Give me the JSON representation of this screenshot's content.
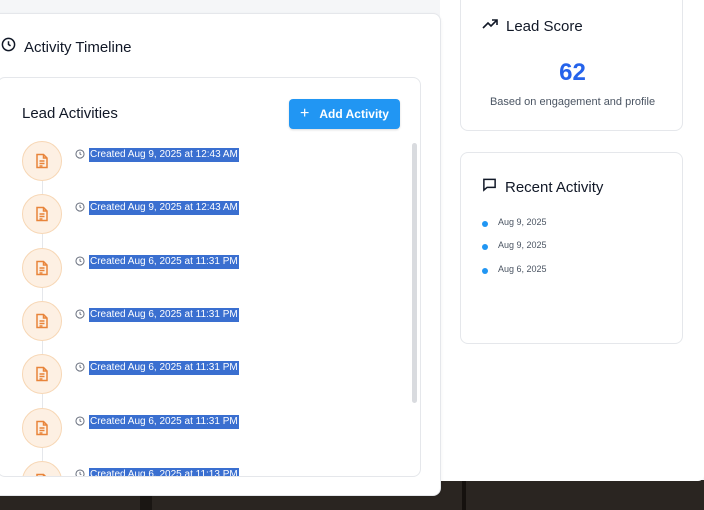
{
  "timeline": {
    "title": "Activity Timeline",
    "icon": "clock-icon"
  },
  "lead_activities": {
    "title": "Lead Activities",
    "add_button_label": "Add Activity",
    "items": [
      {
        "text": "Created Aug 9, 2025 at 12:43 AM"
      },
      {
        "text": "Created Aug 9, 2025 at 12:43 AM"
      },
      {
        "text": "Created Aug 6, 2025 at 11:31 PM"
      },
      {
        "text": "Created Aug 6, 2025 at 11:31 PM"
      },
      {
        "text": "Created Aug 6, 2025 at 11:31 PM"
      },
      {
        "text": "Created Aug 6, 2025 at 11:31 PM"
      },
      {
        "text": "Created Aug 6, 2025 at 11:13 PM"
      }
    ],
    "item_icon": "document-icon",
    "accent_color": "#2196f3",
    "icon_color": "#e8843a"
  },
  "lead_score": {
    "title": "Lead Score",
    "value": "62",
    "subtitle": "Based on engagement and profile",
    "icon": "trending-up-icon",
    "value_color": "#2563eb"
  },
  "recent_activity": {
    "title": "Recent Activity",
    "icon": "message-square-icon",
    "items": [
      {
        "date": "Aug 9, 2025"
      },
      {
        "date": "Aug 9, 2025"
      },
      {
        "date": "Aug 6, 2025"
      }
    ]
  }
}
